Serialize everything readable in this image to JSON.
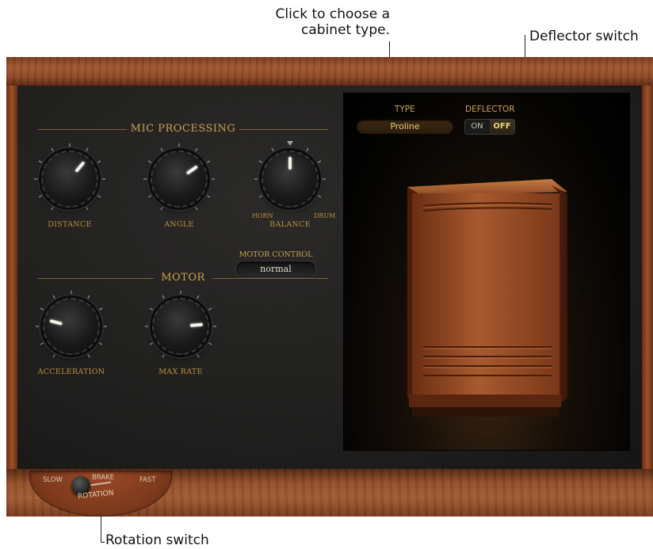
{
  "callouts": {
    "type_line1": "Click to choose a",
    "type_line2": "cabinet type.",
    "deflector": "Deflector switch",
    "rotation": "Rotation switch"
  },
  "mic_processing": {
    "title": "MIC PROCESSING",
    "knobs": [
      {
        "label": "DISTANCE"
      },
      {
        "label": "ANGLE"
      },
      {
        "label": "BALANCE",
        "left_label": "HORN",
        "right_label": "DRUM"
      }
    ]
  },
  "motor": {
    "title": "MOTOR",
    "knobs": [
      {
        "label": "ACCELERATION"
      },
      {
        "label": "MAX RATE"
      }
    ],
    "motor_control": {
      "label": "MOTOR CONTROL",
      "value": "normal"
    }
  },
  "cabinet": {
    "type_label": "TYPE",
    "type_value": "Proline",
    "deflector_label": "DEFLECTOR",
    "deflector_on": "ON",
    "deflector_off": "OFF",
    "deflector_state": "OFF"
  },
  "rotation": {
    "slow": "SLOW",
    "brake": "BRAKE",
    "fast": "FAST",
    "title": "ROTATION",
    "state": "SLOW"
  },
  "colors": {
    "wood": "#94502a",
    "panel": "#1d1c1b",
    "label_gold": "#c9a34f"
  }
}
